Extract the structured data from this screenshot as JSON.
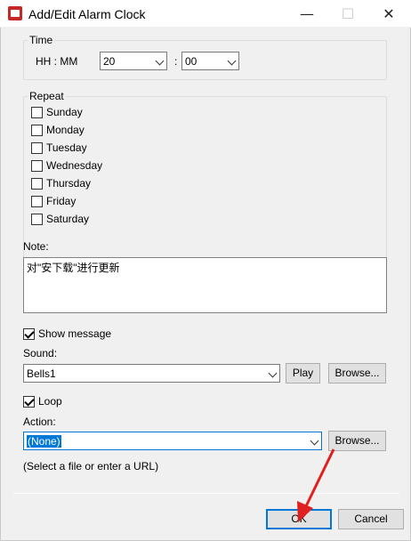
{
  "window": {
    "title": "Add/Edit Alarm Clock",
    "minimize_glyph": "—",
    "maximize_glyph": "☐",
    "close_glyph": "✕",
    "icon": "alarm-clock-app-icon"
  },
  "time": {
    "label": "Time",
    "format_label": "HH : MM",
    "hour": "20",
    "separator": ":",
    "minute": "00"
  },
  "repeat": {
    "label": "Repeat",
    "days": [
      {
        "label": "Sunday",
        "checked": false
      },
      {
        "label": "Monday",
        "checked": false
      },
      {
        "label": "Tuesday",
        "checked": false
      },
      {
        "label": "Wednesday",
        "checked": false
      },
      {
        "label": "Thursday",
        "checked": false
      },
      {
        "label": "Friday",
        "checked": false
      },
      {
        "label": "Saturday",
        "checked": false
      }
    ]
  },
  "note": {
    "label": "Note:",
    "value": "对\"安下载\"进行更新"
  },
  "show_message": {
    "label": "Show message",
    "checked": true
  },
  "sound": {
    "label": "Sound:",
    "value": "Bells1",
    "play_label": "Play",
    "browse_label": "Browse..."
  },
  "loop": {
    "label": "Loop",
    "checked": true
  },
  "action": {
    "label": "Action:",
    "value": "(None)",
    "browse_label": "Browse...",
    "hint": "(Select a file or enter a URL)"
  },
  "footer": {
    "ok_label": "OK",
    "cancel_label": "Cancel"
  },
  "colors": {
    "dialog_bg": "#f0f0f0",
    "accent": "#0078d7",
    "arrow": "#e02020"
  }
}
